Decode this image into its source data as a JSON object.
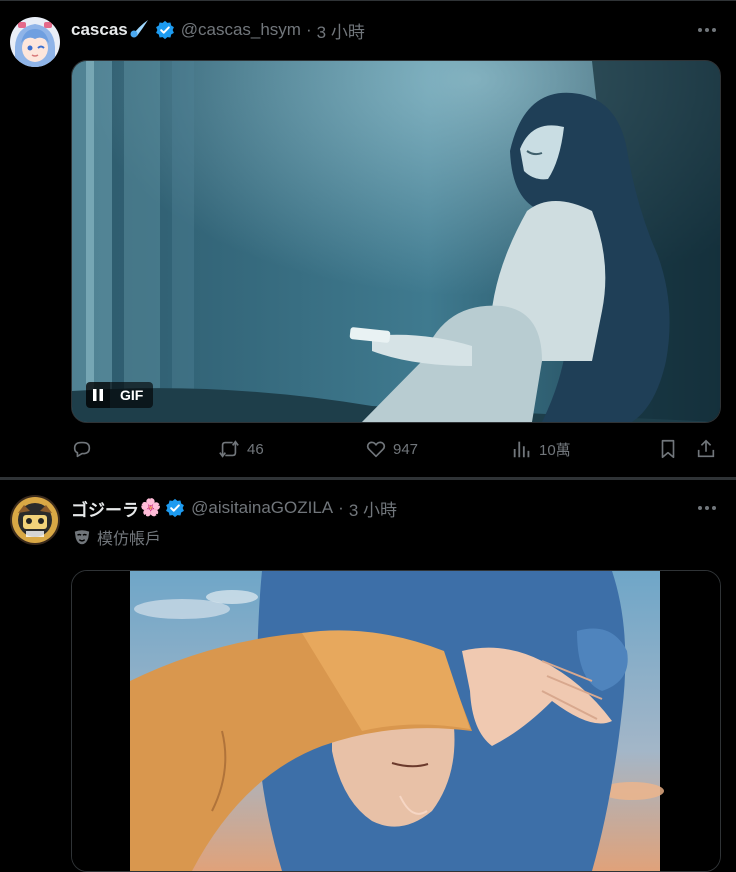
{
  "posts": [
    {
      "display_name": "cascas",
      "name_emoji": "comet",
      "handle": "@cascas_hsym",
      "separator": "·",
      "time": "3 小時",
      "media": {
        "type": "GIF",
        "badge": "GIF",
        "playing": true
      },
      "stats": {
        "reply_count": "",
        "retweet_count": "46",
        "like_count": "947",
        "view_count": "10萬"
      }
    },
    {
      "display_name": "ゴジーラ",
      "name_emoji": "🌸",
      "handle": "@aisitainaGOZILA",
      "separator": "·",
      "time": "3 小時",
      "label": "模仿帳戶",
      "media": {
        "type": "video"
      }
    }
  ],
  "colors": {
    "background": "#000000",
    "text_primary": "#e7e9ea",
    "text_secondary": "#71767b",
    "verified": "#1d9bf0",
    "divider": "#2f3336"
  }
}
